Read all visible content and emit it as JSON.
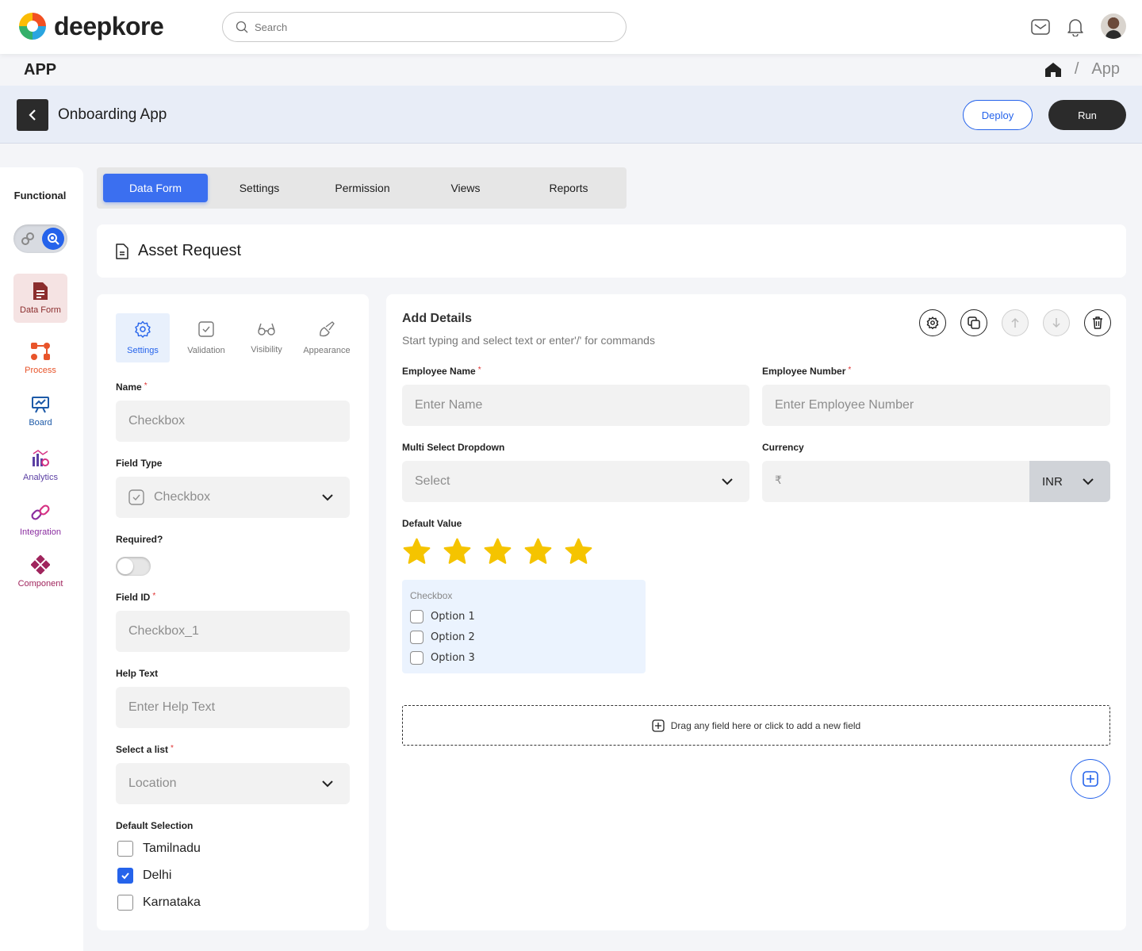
{
  "brand": {
    "name": "deepkore"
  },
  "search": {
    "placeholder": "Search"
  },
  "header": {
    "section_title": "APP",
    "breadcrumb": {
      "sep": "/",
      "current": "App"
    }
  },
  "app_bar": {
    "title": "Onboarding App",
    "deploy_label": "Deploy",
    "run_label": "Run"
  },
  "rail": {
    "heading": "Functional",
    "items": [
      {
        "label": "Data Form",
        "color": "#8b2d2d"
      },
      {
        "label": "Process",
        "color": "#e8542a"
      },
      {
        "label": "Board",
        "color": "#1d5aa8"
      },
      {
        "label": "Analytics",
        "color": "#5b3fa3"
      },
      {
        "label": "Integration",
        "color": "#8a2da0"
      },
      {
        "label": "Component",
        "color": "#a0255d"
      }
    ]
  },
  "tabs": [
    "Data Form",
    "Settings",
    "Permission",
    "Views",
    "Reports"
  ],
  "form": {
    "title": "Asset Request"
  },
  "props": {
    "tabs": [
      "Settings",
      "Validation",
      "Visibility",
      "Appearance"
    ],
    "name_label": "Name",
    "name_value": "Checkbox",
    "field_type_label": "Field Type",
    "field_type_value": "Checkbox",
    "required_label": "Required?",
    "required_on": false,
    "field_id_label": "Field ID",
    "field_id_value": "Checkbox_1",
    "help_text_label": "Help Text",
    "help_text_placeholder": "Enter Help Text",
    "select_list_label": "Select a list",
    "select_list_value": "Location",
    "default_selection_label": "Default Selection",
    "default_options": [
      {
        "label": "Tamilnadu",
        "checked": false
      },
      {
        "label": "Delhi",
        "checked": true
      },
      {
        "label": "Karnataka",
        "checked": false
      }
    ],
    "required_mark": "*"
  },
  "canvas": {
    "title": "Add Details",
    "subtitle": "Start typing and select text or enter'/' for commands",
    "employee_name_label": "Employee Name",
    "employee_name_placeholder": "Enter Name",
    "employee_number_label": "Employee Number",
    "employee_number_placeholder": "Enter Employee Number",
    "multi_select_label": "Multi Select Dropdown",
    "multi_select_value": "Select",
    "currency_label": "Currency",
    "currency_symbol": "₹",
    "currency_code": "INR",
    "default_value_label": "Default Value",
    "rating": 5,
    "rating_max": 5,
    "star_color": "#f5c400",
    "checkbox_group_title": "Checkbox",
    "checkbox_options": [
      "Option 1",
      "Option 2",
      "Option 3"
    ],
    "dropzone_text": "Drag any field here or click to add a new field"
  },
  "colors": {
    "accent": "#2563eb",
    "dark": "#2b2b2b"
  }
}
